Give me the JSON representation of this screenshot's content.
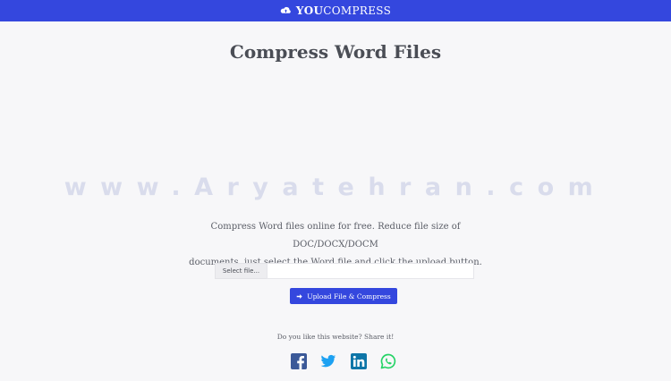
{
  "header": {
    "brand_bold": "YOU",
    "brand_rest": "COMPRESS",
    "logo_icon": "cloud-upload-icon",
    "background_color": "#3447de"
  },
  "main": {
    "title": "Compress Word Files",
    "watermark": "www.Aryatehran.com",
    "description_line1": "Compress Word files online for free. Reduce file size of DOC/DOCX/DOCM",
    "description_line2": "documents, just select the Word file and click the upload button.",
    "file_input": {
      "select_label": "Select file...",
      "value": "",
      "placeholder": ""
    },
    "upload_button": {
      "label": "Upload File & Compress",
      "icon": "arrow-right-icon",
      "color": "#3447de"
    },
    "share": {
      "label": "Do you like this website? Share it!",
      "icons": [
        "facebook-icon",
        "twitter-icon",
        "linkedin-icon",
        "whatsapp-icon"
      ],
      "colors": {
        "facebook": "#3b5998",
        "twitter": "#1da1f2",
        "linkedin": "#0e76a8",
        "whatsapp": "#25d366"
      }
    }
  }
}
